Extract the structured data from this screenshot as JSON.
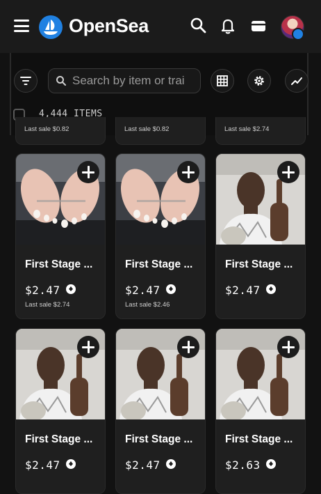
{
  "header": {
    "brand": "OpenSea",
    "icons": [
      "menu-icon",
      "opensea-logo-icon",
      "search-icon",
      "bell-icon",
      "wallet-icon",
      "avatar"
    ]
  },
  "filters": {
    "search_placeholder": "Search by item or trai",
    "items_count": "4,444 ITEMS",
    "icons": [
      "filter-icon",
      "grid-icon",
      "settings-icon",
      "activity-chart-icon"
    ]
  },
  "partial_row": [
    {
      "last_sale": "Last sale $0.82"
    },
    {
      "last_sale": "Last sale $0.82"
    },
    {
      "last_sale": "Last sale $2.74"
    }
  ],
  "cards": [
    {
      "name": "First Stage ...",
      "price": "$2.47",
      "last_sale": "Last sale $2.74",
      "image": "feet"
    },
    {
      "name": "First Stage ...",
      "price": "$2.47",
      "last_sale": "Last sale $2.46",
      "image": "feet"
    },
    {
      "name": "First Stage ...",
      "price": "$2.47",
      "last_sale": "",
      "image": "man-finger"
    },
    {
      "name": "First Stage ...",
      "price": "$2.47",
      "last_sale": "",
      "image": "man-finger"
    },
    {
      "name": "First Stage ...",
      "price": "$2.47",
      "last_sale": "",
      "image": "man-finger"
    },
    {
      "name": "First Stage ...",
      "price": "$2.63",
      "last_sale": "",
      "image": "man-finger"
    }
  ],
  "colors": {
    "accent": "#2081e2",
    "background": "#121212",
    "card": "#1f1f1f"
  }
}
